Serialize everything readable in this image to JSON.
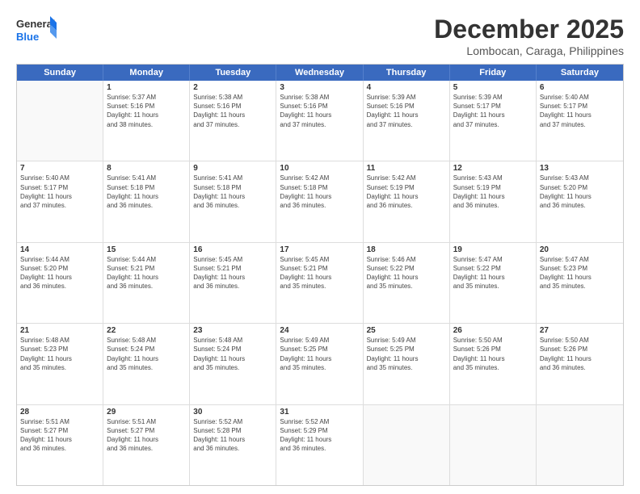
{
  "header": {
    "logo_line1": "General",
    "logo_line2": "Blue",
    "month": "December 2025",
    "location": "Lombocan, Caraga, Philippines"
  },
  "weekdays": [
    "Sunday",
    "Monday",
    "Tuesday",
    "Wednesday",
    "Thursday",
    "Friday",
    "Saturday"
  ],
  "rows": [
    [
      {
        "day": "",
        "info": ""
      },
      {
        "day": "1",
        "info": "Sunrise: 5:37 AM\nSunset: 5:16 PM\nDaylight: 11 hours\nand 38 minutes."
      },
      {
        "day": "2",
        "info": "Sunrise: 5:38 AM\nSunset: 5:16 PM\nDaylight: 11 hours\nand 37 minutes."
      },
      {
        "day": "3",
        "info": "Sunrise: 5:38 AM\nSunset: 5:16 PM\nDaylight: 11 hours\nand 37 minutes."
      },
      {
        "day": "4",
        "info": "Sunrise: 5:39 AM\nSunset: 5:16 PM\nDaylight: 11 hours\nand 37 minutes."
      },
      {
        "day": "5",
        "info": "Sunrise: 5:39 AM\nSunset: 5:17 PM\nDaylight: 11 hours\nand 37 minutes."
      },
      {
        "day": "6",
        "info": "Sunrise: 5:40 AM\nSunset: 5:17 PM\nDaylight: 11 hours\nand 37 minutes."
      }
    ],
    [
      {
        "day": "7",
        "info": "Sunrise: 5:40 AM\nSunset: 5:17 PM\nDaylight: 11 hours\nand 37 minutes."
      },
      {
        "day": "8",
        "info": "Sunrise: 5:41 AM\nSunset: 5:18 PM\nDaylight: 11 hours\nand 36 minutes."
      },
      {
        "day": "9",
        "info": "Sunrise: 5:41 AM\nSunset: 5:18 PM\nDaylight: 11 hours\nand 36 minutes."
      },
      {
        "day": "10",
        "info": "Sunrise: 5:42 AM\nSunset: 5:18 PM\nDaylight: 11 hours\nand 36 minutes."
      },
      {
        "day": "11",
        "info": "Sunrise: 5:42 AM\nSunset: 5:19 PM\nDaylight: 11 hours\nand 36 minutes."
      },
      {
        "day": "12",
        "info": "Sunrise: 5:43 AM\nSunset: 5:19 PM\nDaylight: 11 hours\nand 36 minutes."
      },
      {
        "day": "13",
        "info": "Sunrise: 5:43 AM\nSunset: 5:20 PM\nDaylight: 11 hours\nand 36 minutes."
      }
    ],
    [
      {
        "day": "14",
        "info": "Sunrise: 5:44 AM\nSunset: 5:20 PM\nDaylight: 11 hours\nand 36 minutes."
      },
      {
        "day": "15",
        "info": "Sunrise: 5:44 AM\nSunset: 5:21 PM\nDaylight: 11 hours\nand 36 minutes."
      },
      {
        "day": "16",
        "info": "Sunrise: 5:45 AM\nSunset: 5:21 PM\nDaylight: 11 hours\nand 36 minutes."
      },
      {
        "day": "17",
        "info": "Sunrise: 5:45 AM\nSunset: 5:21 PM\nDaylight: 11 hours\nand 35 minutes."
      },
      {
        "day": "18",
        "info": "Sunrise: 5:46 AM\nSunset: 5:22 PM\nDaylight: 11 hours\nand 35 minutes."
      },
      {
        "day": "19",
        "info": "Sunrise: 5:47 AM\nSunset: 5:22 PM\nDaylight: 11 hours\nand 35 minutes."
      },
      {
        "day": "20",
        "info": "Sunrise: 5:47 AM\nSunset: 5:23 PM\nDaylight: 11 hours\nand 35 minutes."
      }
    ],
    [
      {
        "day": "21",
        "info": "Sunrise: 5:48 AM\nSunset: 5:23 PM\nDaylight: 11 hours\nand 35 minutes."
      },
      {
        "day": "22",
        "info": "Sunrise: 5:48 AM\nSunset: 5:24 PM\nDaylight: 11 hours\nand 35 minutes."
      },
      {
        "day": "23",
        "info": "Sunrise: 5:48 AM\nSunset: 5:24 PM\nDaylight: 11 hours\nand 35 minutes."
      },
      {
        "day": "24",
        "info": "Sunrise: 5:49 AM\nSunset: 5:25 PM\nDaylight: 11 hours\nand 35 minutes."
      },
      {
        "day": "25",
        "info": "Sunrise: 5:49 AM\nSunset: 5:25 PM\nDaylight: 11 hours\nand 35 minutes."
      },
      {
        "day": "26",
        "info": "Sunrise: 5:50 AM\nSunset: 5:26 PM\nDaylight: 11 hours\nand 35 minutes."
      },
      {
        "day": "27",
        "info": "Sunrise: 5:50 AM\nSunset: 5:26 PM\nDaylight: 11 hours\nand 36 minutes."
      }
    ],
    [
      {
        "day": "28",
        "info": "Sunrise: 5:51 AM\nSunset: 5:27 PM\nDaylight: 11 hours\nand 36 minutes."
      },
      {
        "day": "29",
        "info": "Sunrise: 5:51 AM\nSunset: 5:27 PM\nDaylight: 11 hours\nand 36 minutes."
      },
      {
        "day": "30",
        "info": "Sunrise: 5:52 AM\nSunset: 5:28 PM\nDaylight: 11 hours\nand 36 minutes."
      },
      {
        "day": "31",
        "info": "Sunrise: 5:52 AM\nSunset: 5:29 PM\nDaylight: 11 hours\nand 36 minutes."
      },
      {
        "day": "",
        "info": ""
      },
      {
        "day": "",
        "info": ""
      },
      {
        "day": "",
        "info": ""
      }
    ]
  ]
}
